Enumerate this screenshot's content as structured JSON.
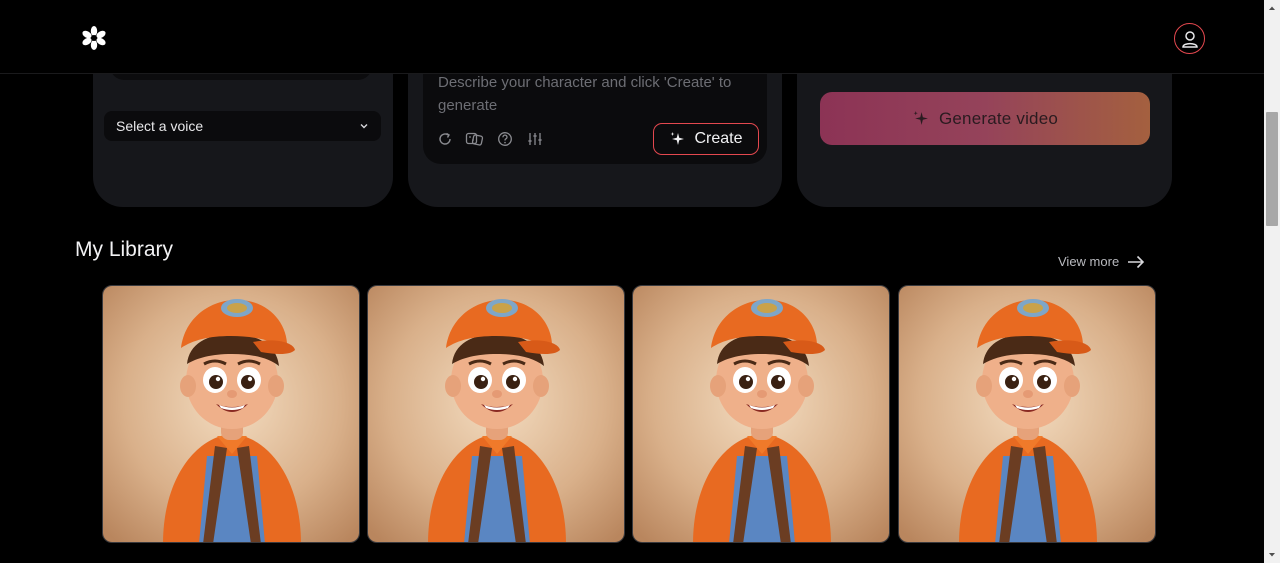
{
  "voice": {
    "select_label": "Select a voice"
  },
  "prompt": {
    "placeholder": "Describe your character and click 'Create' to generate",
    "create_label": "Create",
    "tools": [
      "refresh-icon",
      "dice-icon",
      "help-icon",
      "sliders-icon"
    ]
  },
  "video": {
    "generate_label": "Generate video"
  },
  "library": {
    "title": "My Library",
    "view_more_label": "View more",
    "items": [
      {
        "alt": "cartoon boy with orange cap and backpack"
      },
      {
        "alt": "cartoon boy with orange cap and backpack"
      },
      {
        "alt": "cartoon boy with orange cap and backpack"
      },
      {
        "alt": "cartoon boy with orange cap and backpack"
      }
    ]
  },
  "colors": {
    "accent": "#e4484f",
    "panel": "#16171b",
    "gradient_start": "#8c3355",
    "gradient_end": "#a4603f"
  }
}
